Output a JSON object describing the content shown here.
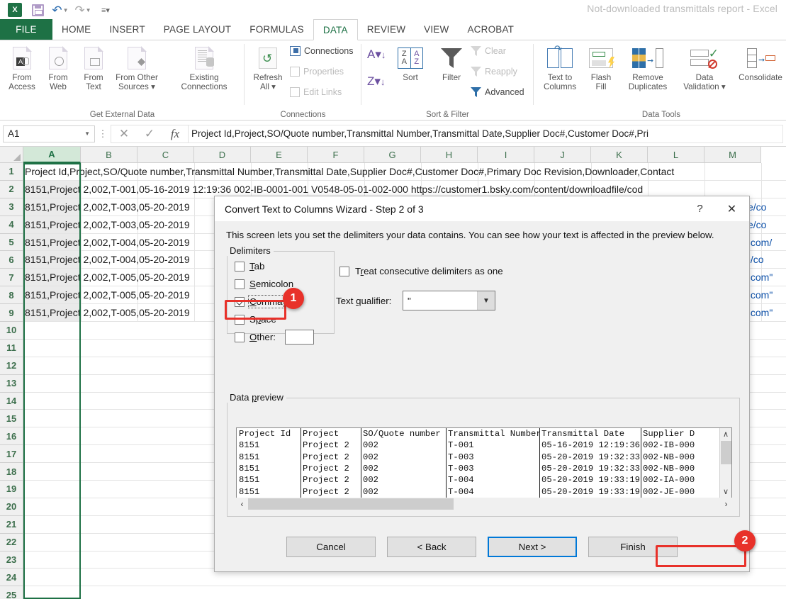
{
  "window": {
    "title": "Not-downloaded transmittals report - Excel",
    "quick_access": [
      "save-icon",
      "undo-icon",
      "redo-icon",
      "customize-qat-icon"
    ],
    "app_logo": "excel-logo"
  },
  "ribbon": {
    "tabs": [
      {
        "label": "FILE",
        "active": false
      },
      {
        "label": "HOME",
        "active": false
      },
      {
        "label": "INSERT",
        "active": false
      },
      {
        "label": "PAGE LAYOUT",
        "active": false
      },
      {
        "label": "FORMULAS",
        "active": false
      },
      {
        "label": "DATA",
        "active": true
      },
      {
        "label": "REVIEW",
        "active": false
      },
      {
        "label": "VIEW",
        "active": false
      },
      {
        "label": "ACROBAT",
        "active": false
      }
    ],
    "groups": [
      {
        "name": "Get External Data",
        "buttons": [
          {
            "line1": "From",
            "line2": "Access"
          },
          {
            "line1": "From",
            "line2": "Web"
          },
          {
            "line1": "From",
            "line2": "Text"
          },
          {
            "line1": "From Other",
            "line2": "Sources ▾"
          },
          {
            "line1": "Existing",
            "line2": "Connections"
          }
        ]
      },
      {
        "name": "Connections",
        "big": {
          "line1": "Refresh",
          "line2": "All ▾"
        },
        "items": [
          "Connections",
          "Properties",
          "Edit Links"
        ]
      },
      {
        "name": "Sort & Filter",
        "sort_az": "A↓",
        "sort_za": "Z↓",
        "sort_label": "Sort",
        "filter_label": "Filter",
        "items": [
          "Clear",
          "Reapply",
          "Advanced"
        ]
      },
      {
        "name": "Data Tools",
        "buttons": [
          {
            "line1": "Text to",
            "line2": "Columns"
          },
          {
            "line1": "Flash",
            "line2": "Fill"
          },
          {
            "line1": "Remove",
            "line2": "Duplicates"
          },
          {
            "line1": "Data",
            "line2": "Validation ▾"
          },
          {
            "line1": "Consolidate",
            "line2": ""
          }
        ]
      }
    ]
  },
  "formula_bar": {
    "name_box": "A1",
    "cancel_icon": "✕",
    "enter_icon": "✓",
    "function_icon": "fx",
    "value": "Project Id,Project,SO/Quote number,Transmittal Number,Transmittal Date,Supplier Doc#,Customer Doc#,Pri"
  },
  "sheet": {
    "columns": [
      "A",
      "B",
      "C",
      "D",
      "E",
      "F",
      "G",
      "H",
      "I",
      "J",
      "K",
      "L",
      "M"
    ],
    "selected_column": "A",
    "rows": [
      1,
      2,
      3,
      4,
      5,
      6,
      7,
      8,
      9,
      10,
      11,
      12,
      13,
      14,
      15,
      16,
      17,
      18,
      19,
      20,
      21,
      22,
      23,
      24,
      25
    ],
    "cells": [
      {
        "row": 1,
        "text": "Project Id,Project,SO/Quote number,Transmittal Number,Transmittal Date,Supplier Doc#,Customer Doc#,Primary Doc Revision,Downloader,Contact"
      },
      {
        "row": 2,
        "text": "8151,Project 2,002,T-001,05-16-2019 12:19:36 002-IB-0001-001 V0548-05-01-002-000 https://customer1.bsky.com/content/downloadfile/cod"
      },
      {
        "row": 3,
        "text": "8151,Project 2,002,T-003,05-20-2019",
        "tail": "/file/co"
      },
      {
        "row": 4,
        "text": "8151,Project 2,002,T-003,05-20-2019",
        "tail": "/file/co"
      },
      {
        "row": 5,
        "text": "8151,Project 2,002,T-004,05-20-2019",
        "tail": "ss.com/"
      },
      {
        "row": 6,
        "text": "8151,Project 2,002,T-004,05-20-2019",
        "tail": "file/co"
      },
      {
        "row": 7,
        "text": "8151,Project 2,002,T-005,05-20-2019",
        "tail": "ss.com\""
      },
      {
        "row": 8,
        "text": "8151,Project 2,002,T-005,05-20-2019",
        "tail": "ss.com\""
      },
      {
        "row": 9,
        "text": "8151,Project 2,002,T-005,05-20-2019",
        "tail": "ss.com\""
      }
    ]
  },
  "dialog": {
    "title": "Convert Text to Columns Wizard - Step 2 of 3",
    "help_icon": "?",
    "close_icon": "✕",
    "description": "This screen lets you set the delimiters your data contains.  You can see how your text is affected in the preview below.",
    "delimiters": {
      "legend": "Delimiters",
      "options": [
        {
          "label": "Tab",
          "checked": false,
          "accel": "T"
        },
        {
          "label": "Semicolon",
          "checked": false,
          "accel": "S"
        },
        {
          "label": "Comma",
          "checked": true,
          "accel": "C"
        },
        {
          "label": "Space",
          "checked": false,
          "accel": "p"
        },
        {
          "label": "Other:",
          "checked": false,
          "accel": "O"
        }
      ],
      "other_value": ""
    },
    "consecutive": {
      "label": "Treat consecutive delimiters as one",
      "checked": false
    },
    "text_qualifier": {
      "label": "Text qualifier:",
      "value": "\""
    },
    "preview": {
      "legend": "Data preview",
      "headers": [
        "Project Id",
        "Project",
        "SO/Quote number",
        "Transmittal Number",
        "Transmittal Date",
        "Supplier D"
      ],
      "rows": [
        [
          "8151",
          "Project 2",
          "002",
          "T-001",
          "05-16-2019 12:19:36",
          "002-IB-000"
        ],
        [
          "8151",
          "Project 2",
          "002",
          "T-003",
          "05-20-2019 19:32:33",
          "002-NB-000"
        ],
        [
          "8151",
          "Project 2",
          "002",
          "T-003",
          "05-20-2019 19:32:33",
          "002-NB-000"
        ],
        [
          "8151",
          "Project 2",
          "002",
          "T-004",
          "05-20-2019 19:33:19",
          "002-IA-000"
        ],
        [
          "8151",
          "Project 2",
          "002",
          "T-004",
          "05-20-2019 19:33:19",
          "002-JE-000"
        ]
      ],
      "scroll_up_icon": "∧",
      "scroll_down_icon": "∨",
      "scroll_left_icon": "‹",
      "scroll_right_icon": "›"
    },
    "buttons": [
      {
        "label": "Cancel",
        "style": "normal"
      },
      {
        "label": "< Back",
        "style": "normal"
      },
      {
        "label": "Next >",
        "style": "default"
      },
      {
        "label": "Finish",
        "style": "highlighted"
      }
    ]
  },
  "callouts": [
    {
      "number": "1",
      "target": "comma-checkbox"
    },
    {
      "number": "2",
      "target": "finish-button"
    }
  ],
  "colors": {
    "excel_green": "#1e7145",
    "callout_red": "#e8312a",
    "default_button_blue": "#0078d7",
    "link_blue": "#0b4fa8"
  }
}
